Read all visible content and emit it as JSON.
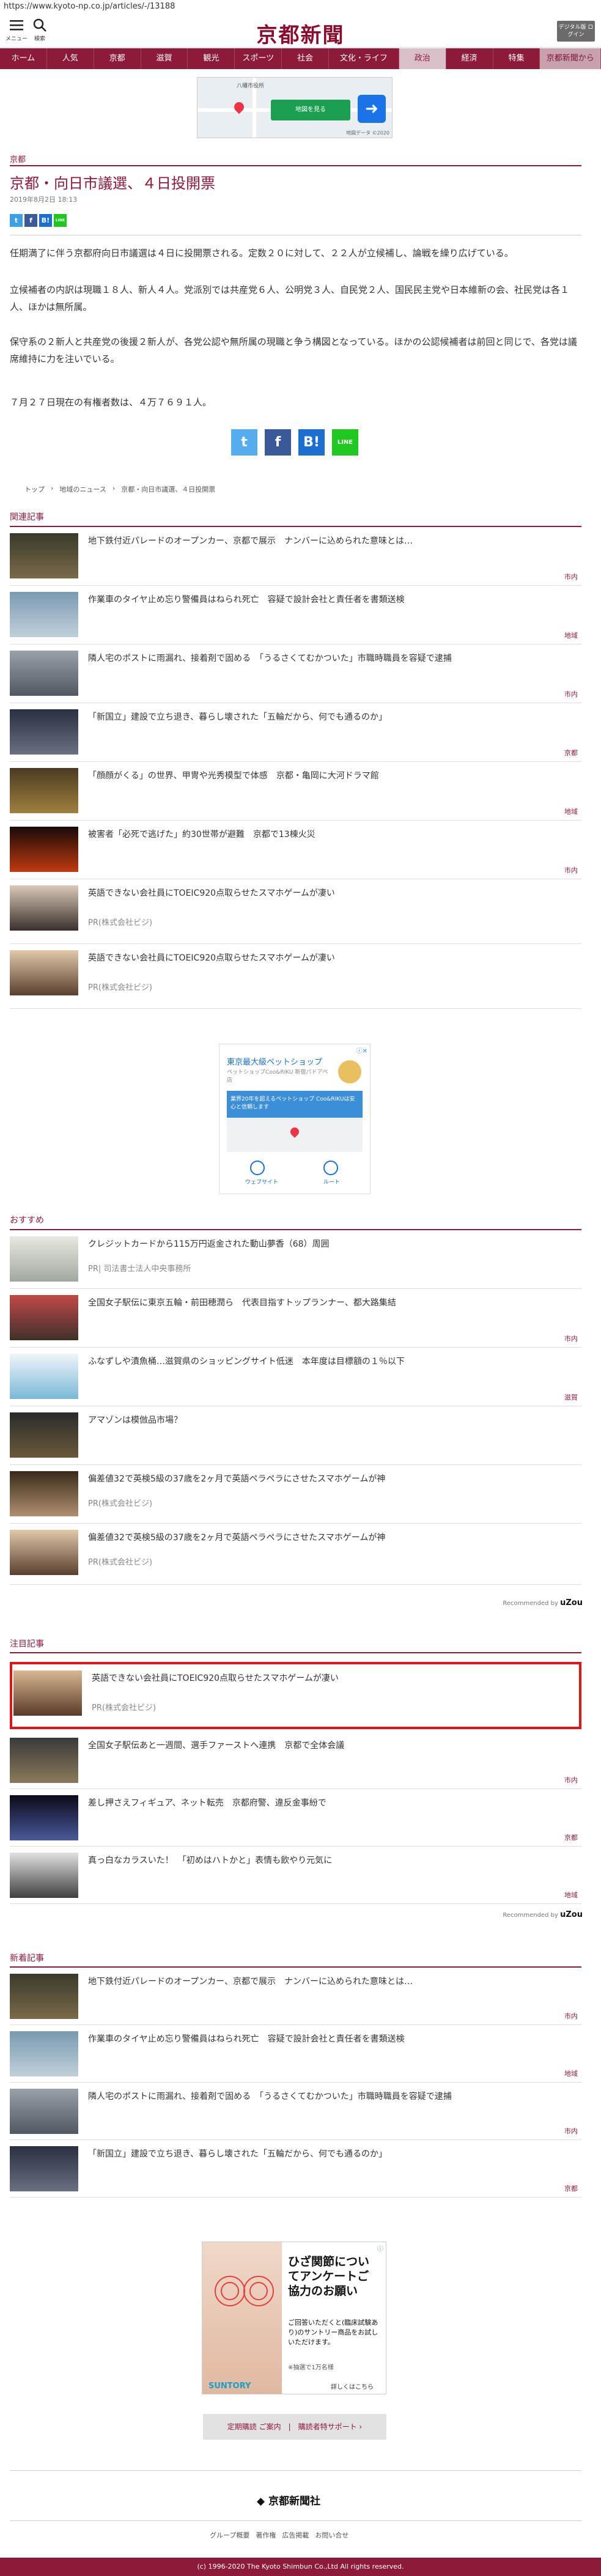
{
  "url": "https://www.kyoto-np.co.jp/articles/-/13188",
  "header": {
    "menu_label": "メニュー",
    "search_label": "検索",
    "logo_text": "京都新聞",
    "digital_button": "デジタル版 ログイン"
  },
  "nav": [
    "ホーム",
    "人気",
    "京都",
    "滋賀",
    "観光",
    "スポーツ",
    "社会",
    "文化・ライフ",
    "政治",
    "経済",
    "特集",
    "京都新聞から"
  ],
  "map_ad": {
    "label": "八幡市役所",
    "cta": "地図を見る",
    "brand": "地図データ ©2020"
  },
  "article": {
    "category": "京都",
    "title": "京都・向日市議選、４日投開票",
    "date": "2019年8月2日 18:13",
    "share_small": [
      "t",
      "f",
      "B!",
      "LINE"
    ],
    "paragraphs": [
      "任期満了に伴う京都府向日市議選は４日に投開票される。定数２０に対して、２２人が立候補し、論戦を繰り広げている。",
      "立候補者の内訳は現職１８人、新人４人。党派別では共産党６人、公明党３人、自民党２人、国民民主党や日本維新の会、社民党は各１人、ほかは無所属。",
      "保守系の２新人と共産党の後援２新人が、各党公認や無所属の現職と争う構図となっている。ほかの公認候補者は前回と同じで、各党は議席維持に力を注いでいる。",
      "７月２７日現在の有権者数は、４万７６９１人。"
    ],
    "share_big": [
      "t",
      "f",
      "B!",
      "LINE"
    ],
    "breadcrumb": [
      "トップ",
      "地域のニュース",
      "京都・向日市議選、４日投開票"
    ]
  },
  "related": {
    "heading": "関連記事",
    "items": [
      {
        "title": "地下鉄付近パレードのオープンカー、京都で展示　ナンバーに込められた意味とは…",
        "tag": "市内"
      },
      {
        "title": "作業車のタイヤ止め忘り警備員はねられ死亡　容疑で設計会社と責任者を書類送検",
        "tag": "地域"
      },
      {
        "title": "隣人宅のポストに雨漏れ、接着剤で固める　「うるさくてむかついた」市職時職員を容疑で逮捕",
        "tag": "市内"
      },
      {
        "title": "「新国立」建設で立ち退き、暮らし壊された「五輪だから、何でも通るのか」",
        "tag": "京都"
      },
      {
        "title": "「顔顔がくる」の世界、甲冑や光秀模型で体感　京都・亀岡に大河ドラマ館",
        "tag": "地域"
      },
      {
        "title": "被害者「必死で逃げた」約30世帯が避難　京都で13棟火災",
        "tag": "市内"
      },
      {
        "title": "英語できない会社員にTOEIC920点取らせたスマホゲームが凄い",
        "pr": "PR(株式会社ビジ)"
      },
      {
        "title": "英語できない会社員にTOEIC920点取らせたスマホゲームが凄い",
        "pr": "PR(株式会社ビジ)"
      }
    ]
  },
  "pet_ad": {
    "title": "東京最大級ペットショップ",
    "desc": "ペットショップCoo&RIKU 新宿パドアペ店",
    "banner": "業界20年を超えるペットショップ Coo&RIKUは安心と信頼します",
    "btn_web": "ウェブサイト",
    "btn_route": "ルート"
  },
  "recommend": {
    "heading": "おすすめ",
    "items": [
      {
        "title": "クレジットカードから115万円返金された動山夢香（68）周囲",
        "pr": "PR| 司法書士法人中央事務所"
      },
      {
        "title": "全国女子駅伝に東京五輪・前田穂潤ら　代表目指すトップランナー、都大路集結",
        "tag": "市内"
      },
      {
        "title": "ふなずしや漬魚桶…滋賀県のショッピングサイト低迷　本年度は目標額の１％以下",
        "tag": "滋賀"
      },
      {
        "title": "アマゾンは模倣品市場？",
        "tag": ""
      },
      {
        "title": "偏差値32で英検5級の37歳を2ヶ月で英語ペラペラにさせたスマホゲームが神",
        "pr": "PR(株式会社ビジ)"
      },
      {
        "title": "偏差値32で英検5級の37歳を2ヶ月で英語ペラペラにさせたスマホゲームが神",
        "pr": "PR(株式会社ビジ)"
      }
    ],
    "recommended_by": "Recommended by",
    "recommended_brand": "uZou"
  },
  "featured": {
    "heading": "注目記事",
    "items": [
      {
        "title": "英語できない会社員にTOEIC920点取らせたスマホゲームが凄い",
        "pr": "PR(株式会社ビジ)"
      },
      {
        "title": "全国女子駅伝あと一週間、選手ファーストへ連携　京都で全体会議",
        "tag": "市内"
      },
      {
        "title": "差し押さえフィギュア、ネット転売　京都府警、違反金事紛で",
        "tag": "京都"
      },
      {
        "title": "真っ白なカラスいた！　「初めはハトかと」表情も飲やり元気に",
        "tag": "地域"
      }
    ],
    "recommended_by": "Recommended by",
    "recommended_brand": "uZou"
  },
  "latest": {
    "heading": "新着記事",
    "items": [
      {
        "title": "地下鉄付近パレードのオープンカー、京都で展示　ナンバーに込められた意味とは…",
        "tag": "市内"
      },
      {
        "title": "作業車のタイヤ止め忘り警備員はねられ死亡　容疑で設計会社と責任者を書類送検",
        "tag": "地域"
      },
      {
        "title": "隣人宅のポストに雨漏れ、接着剤で固める　「うるさくてむかついた」市職時職員を容疑で逮捕",
        "tag": "市内"
      },
      {
        "title": "「新国立」建設で立ち退き、暮らし壊された「五輪だから、何でも通るのか」",
        "tag": "京都"
      }
    ]
  },
  "knee_ad": {
    "headline": "ひざ関節についてアンケートご協力のお願い",
    "body": "ご回答いただくと(臨床試験あり)のサントリー商品をお試しいただけます。",
    "note": "※抽選で1万名様",
    "brand": "SUNTORY",
    "more": "詳しくはこちら"
  },
  "support_button": "定期購読 ご案内　|　購読者特サポート ›",
  "footer": {
    "logo": "京都新聞社",
    "links": [
      "グループ概要",
      "著作権",
      "広告掲載",
      "お問い合せ"
    ],
    "copyright": "(c) 1996-2020 The Kyoto Shimbun Co.,Ltd All rights reserved."
  },
  "colors": {
    "brand": "#8e1a3a",
    "highlight": "#e01616"
  }
}
